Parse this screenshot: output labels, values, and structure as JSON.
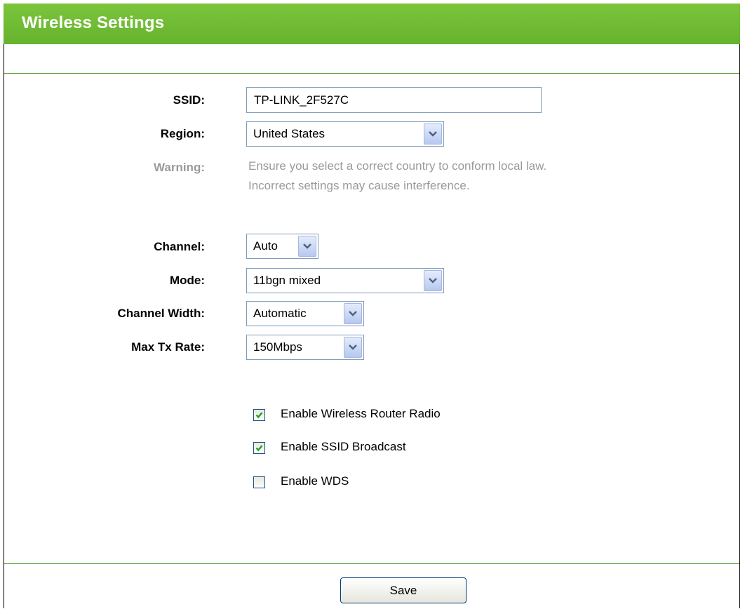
{
  "header": {
    "title": "Wireless Settings",
    "accent_color": "#66b32e"
  },
  "form": {
    "ssid": {
      "label": "SSID:",
      "value": "TP-LINK_2F527C"
    },
    "region": {
      "label": "Region:",
      "value": "United States"
    },
    "warning": {
      "label": "Warning:",
      "line1": "Ensure you select a correct country to conform local law.",
      "line2": "Incorrect settings may cause interference."
    },
    "channel": {
      "label": "Channel:",
      "value": "Auto"
    },
    "mode": {
      "label": "Mode:",
      "value": "11bgn mixed"
    },
    "channel_width": {
      "label": "Channel Width:",
      "value": "Automatic"
    },
    "max_tx_rate": {
      "label": "Max Tx Rate:",
      "value": "150Mbps"
    }
  },
  "options": [
    {
      "label": "Enable Wireless Router Radio",
      "checked": true
    },
    {
      "label": "Enable SSID Broadcast",
      "checked": true
    },
    {
      "label": "Enable WDS",
      "checked": false
    }
  ],
  "footer": {
    "save_label": "Save"
  }
}
